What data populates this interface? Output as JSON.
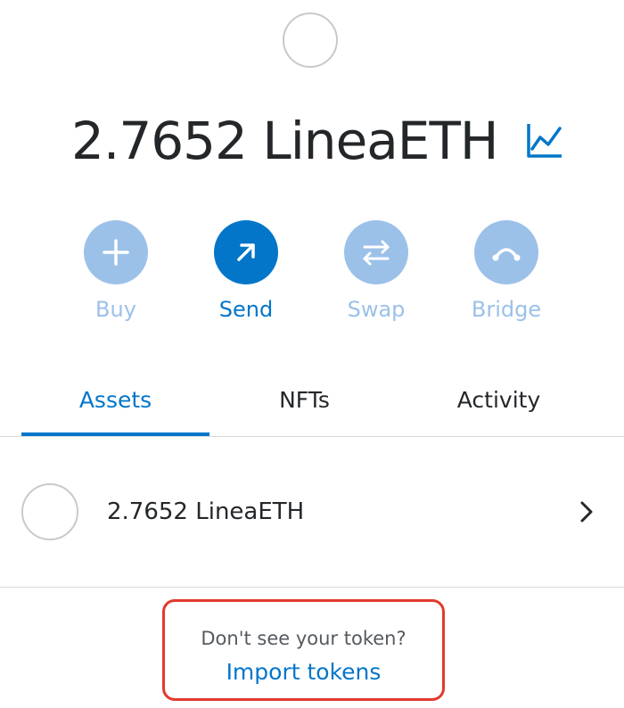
{
  "account": {
    "balance_display": "2.7652 LineaETH",
    "chart_icon": "line-chart-icon"
  },
  "actions": [
    {
      "label": "Buy",
      "icon": "plus-icon",
      "state": "disabled"
    },
    {
      "label": "Send",
      "icon": "arrow-up-right-icon",
      "state": "enabled"
    },
    {
      "label": "Swap",
      "icon": "swap-arrows-icon",
      "state": "disabled"
    },
    {
      "label": "Bridge",
      "icon": "bridge-icon",
      "state": "disabled"
    }
  ],
  "tabs": [
    {
      "label": "Assets",
      "active": true
    },
    {
      "label": "NFTs",
      "active": false
    },
    {
      "label": "Activity",
      "active": false
    }
  ],
  "assets": [
    {
      "label": "2.7652 LineaETH",
      "icon": "token-placeholder-icon",
      "chevron": "chevron-right-icon"
    }
  ],
  "import": {
    "hint": "Don't see your token?",
    "link": "Import tokens"
  },
  "colors": {
    "primary": "#0376c9",
    "disabled": "#9cc1e9",
    "text": "#24272a",
    "highlight_border": "#e23a2f"
  }
}
